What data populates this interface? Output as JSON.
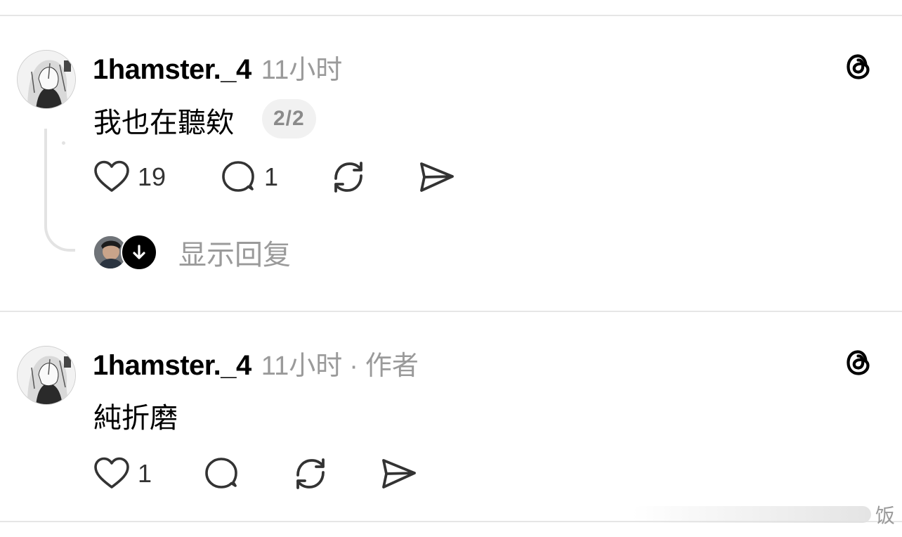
{
  "posts": [
    {
      "username": "1hamster._4",
      "time": "11小时",
      "author_tag": "",
      "text": "我也在聽欸",
      "page_indicator": "2/2",
      "likes": "19",
      "comments": "1",
      "show_replies_label": "显示回复"
    },
    {
      "username": "1hamster._4",
      "time": "11小时",
      "separator": "·",
      "author_tag": "作者",
      "text": "純折磨",
      "likes": "1",
      "comments": ""
    }
  ],
  "icons": {
    "app_logo": "threads-logo-icon",
    "like": "heart-icon",
    "comment": "comment-bubble-icon",
    "repost": "repost-icon",
    "share": "send-icon",
    "show_replies": "arrow-down-icon"
  },
  "colors": {
    "background": "#ffffff",
    "text": "#000000",
    "secondary_text": "#9a9a9a",
    "divider": "#e6e6e6"
  },
  "watermark": {
    "text": "饭"
  }
}
